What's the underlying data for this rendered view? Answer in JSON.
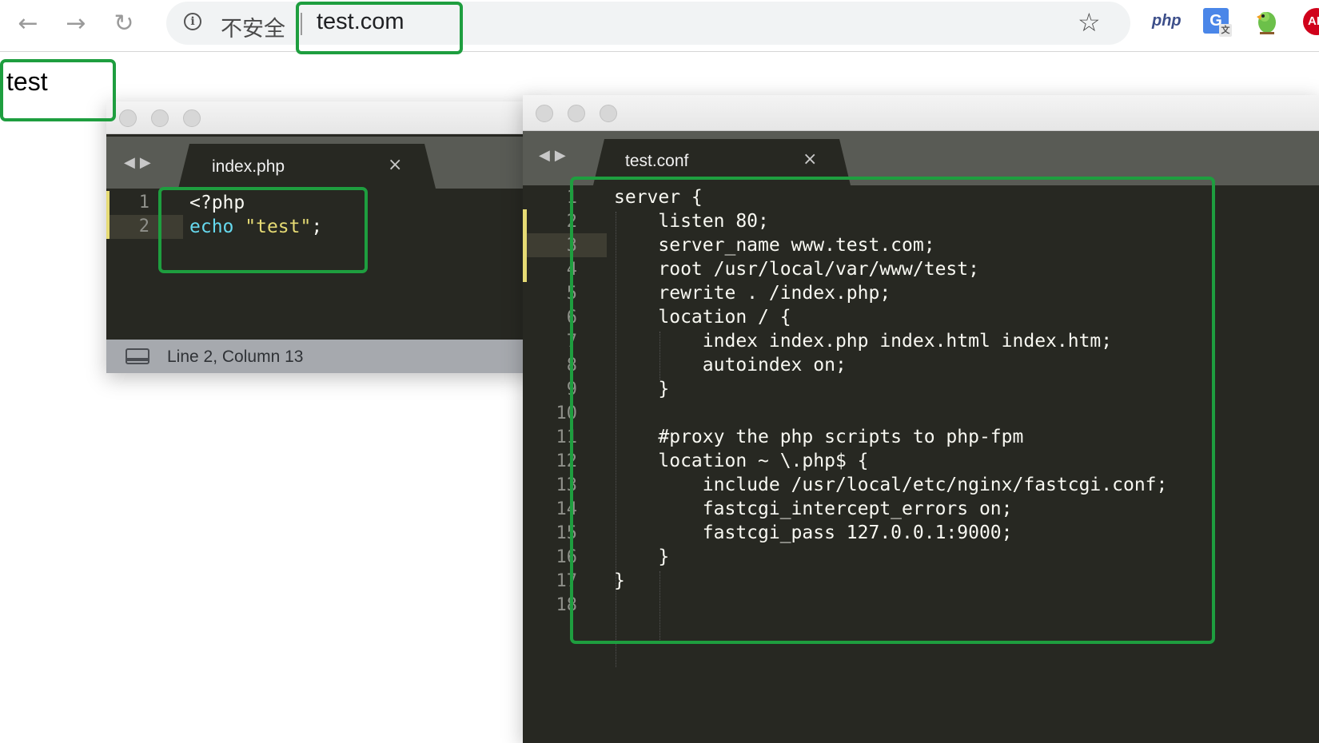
{
  "browser": {
    "back_icon": "arrow-left-icon",
    "forward_icon": "arrow-right-icon",
    "reload_icon": "reload-icon",
    "security_icon": "info-icon",
    "security_label": "不安全",
    "url": "test.com",
    "bookmark_icon": "star-icon",
    "extensions": [
      {
        "name": "php-extension-icon",
        "text": "php"
      },
      {
        "name": "google-translate-icon",
        "text": "G"
      },
      {
        "name": "parrot-extension-icon",
        "text": ""
      },
      {
        "name": "adblock-icon",
        "text": "ABP"
      }
    ]
  },
  "page": {
    "output_text": "test"
  },
  "editor_php": {
    "tab_label": "index.php",
    "close_glyph": "×",
    "line_numbers": [
      "1",
      "2"
    ],
    "lines": [
      [
        {
          "t": "<?php",
          "c": "plain"
        }
      ],
      [
        {
          "t": "echo",
          "c": "kw"
        },
        {
          "t": " ",
          "c": "plain"
        },
        {
          "t": "\"test\"",
          "c": "str"
        },
        {
          "t": ";",
          "c": "plain"
        }
      ]
    ],
    "status": "Line 2, Column 13"
  },
  "editor_conf": {
    "tab_label": "test.conf",
    "close_glyph": "×",
    "line_numbers": [
      "1",
      "2",
      "3",
      "4",
      "5",
      "6",
      "7",
      "8",
      "9",
      "10",
      "11",
      "12",
      "13",
      "14",
      "15",
      "16",
      "17",
      "18"
    ],
    "lines": [
      "server {",
      "    listen 80;",
      "    server_name www.test.com;",
      "    root /usr/local/var/www/test;",
      "    rewrite . /index.php;",
      "    location / {",
      "        index index.php index.html index.htm;",
      "        autoindex on;",
      "    }",
      "",
      "    #proxy the php scripts to php-fpm",
      "    location ~ \\.php$ {",
      "        include /usr/local/etc/nginx/fastcgi.conf;",
      "        fastcgi_intercept_errors on;",
      "        fastcgi_pass 127.0.0.1:9000;",
      "    }",
      "}",
      ""
    ]
  },
  "colors": {
    "highlight": "#1e9e3f",
    "editor_bg": "#272822",
    "keyword": "#66d9ef",
    "string": "#e6db74"
  }
}
